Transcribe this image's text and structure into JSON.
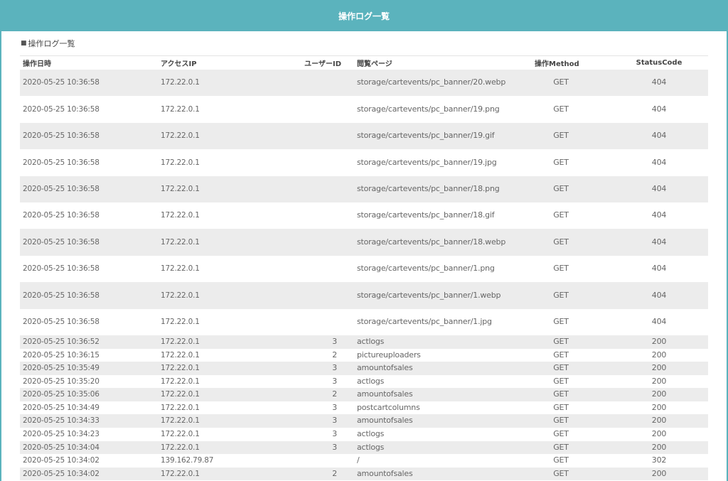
{
  "header": {
    "title": "操作ログ一覧"
  },
  "section": {
    "bullet": "■",
    "title": "操作ログ一覧"
  },
  "table": {
    "columns": [
      "操作日時",
      "アクセスIP",
      "ユーザーID",
      "閲覧ページ",
      "操作Method",
      "StatusCode"
    ],
    "rows": [
      {
        "datetime": "2020-05-25 10:36:58",
        "ip": "172.22.0.1",
        "user_id": "",
        "page": "storage/cartevents/pc_banner/20.webp",
        "method": "GET",
        "status": "404"
      },
      {
        "datetime": "2020-05-25 10:36:58",
        "ip": "172.22.0.1",
        "user_id": "",
        "page": "storage/cartevents/pc_banner/19.png",
        "method": "GET",
        "status": "404"
      },
      {
        "datetime": "2020-05-25 10:36:58",
        "ip": "172.22.0.1",
        "user_id": "",
        "page": "storage/cartevents/pc_banner/19.gif",
        "method": "GET",
        "status": "404"
      },
      {
        "datetime": "2020-05-25 10:36:58",
        "ip": "172.22.0.1",
        "user_id": "",
        "page": "storage/cartevents/pc_banner/19.jpg",
        "method": "GET",
        "status": "404"
      },
      {
        "datetime": "2020-05-25 10:36:58",
        "ip": "172.22.0.1",
        "user_id": "",
        "page": "storage/cartevents/pc_banner/18.png",
        "method": "GET",
        "status": "404"
      },
      {
        "datetime": "2020-05-25 10:36:58",
        "ip": "172.22.0.1",
        "user_id": "",
        "page": "storage/cartevents/pc_banner/18.gif",
        "method": "GET",
        "status": "404"
      },
      {
        "datetime": "2020-05-25 10:36:58",
        "ip": "172.22.0.1",
        "user_id": "",
        "page": "storage/cartevents/pc_banner/18.webp",
        "method": "GET",
        "status": "404"
      },
      {
        "datetime": "2020-05-25 10:36:58",
        "ip": "172.22.0.1",
        "user_id": "",
        "page": "storage/cartevents/pc_banner/1.png",
        "method": "GET",
        "status": "404"
      },
      {
        "datetime": "2020-05-25 10:36:58",
        "ip": "172.22.0.1",
        "user_id": "",
        "page": "storage/cartevents/pc_banner/1.webp",
        "method": "GET",
        "status": "404"
      },
      {
        "datetime": "2020-05-25 10:36:58",
        "ip": "172.22.0.1",
        "user_id": "",
        "page": "storage/cartevents/pc_banner/1.jpg",
        "method": "GET",
        "status": "404"
      },
      {
        "datetime": "2020-05-25 10:36:52",
        "ip": "172.22.0.1",
        "user_id": "3",
        "page": "actlogs",
        "method": "GET",
        "status": "200"
      },
      {
        "datetime": "2020-05-25 10:36:15",
        "ip": "172.22.0.1",
        "user_id": "2",
        "page": "pictureuploaders",
        "method": "GET",
        "status": "200"
      },
      {
        "datetime": "2020-05-25 10:35:49",
        "ip": "172.22.0.1",
        "user_id": "3",
        "page": "amountofsales",
        "method": "GET",
        "status": "200"
      },
      {
        "datetime": "2020-05-25 10:35:20",
        "ip": "172.22.0.1",
        "user_id": "3",
        "page": "actlogs",
        "method": "GET",
        "status": "200"
      },
      {
        "datetime": "2020-05-25 10:35:06",
        "ip": "172.22.0.1",
        "user_id": "2",
        "page": "amountofsales",
        "method": "GET",
        "status": "200"
      },
      {
        "datetime": "2020-05-25 10:34:49",
        "ip": "172.22.0.1",
        "user_id": "3",
        "page": "postcartcolumns",
        "method": "GET",
        "status": "200"
      },
      {
        "datetime": "2020-05-25 10:34:33",
        "ip": "172.22.0.1",
        "user_id": "3",
        "page": "amountofsales",
        "method": "GET",
        "status": "200"
      },
      {
        "datetime": "2020-05-25 10:34:23",
        "ip": "172.22.0.1",
        "user_id": "3",
        "page": "actlogs",
        "method": "GET",
        "status": "200"
      },
      {
        "datetime": "2020-05-25 10:34:04",
        "ip": "172.22.0.1",
        "user_id": "3",
        "page": "actlogs",
        "method": "GET",
        "status": "200"
      },
      {
        "datetime": "2020-05-25 10:34:02",
        "ip": "139.162.79.87",
        "user_id": "",
        "page": "/",
        "method": "GET",
        "status": "302"
      },
      {
        "datetime": "2020-05-25 10:34:02",
        "ip": "172.22.0.1",
        "user_id": "2",
        "page": "amountofsales",
        "method": "GET",
        "status": "200"
      }
    ]
  },
  "colors": {
    "header_bg": "#5bb3bd",
    "stripe": "#ececec"
  }
}
